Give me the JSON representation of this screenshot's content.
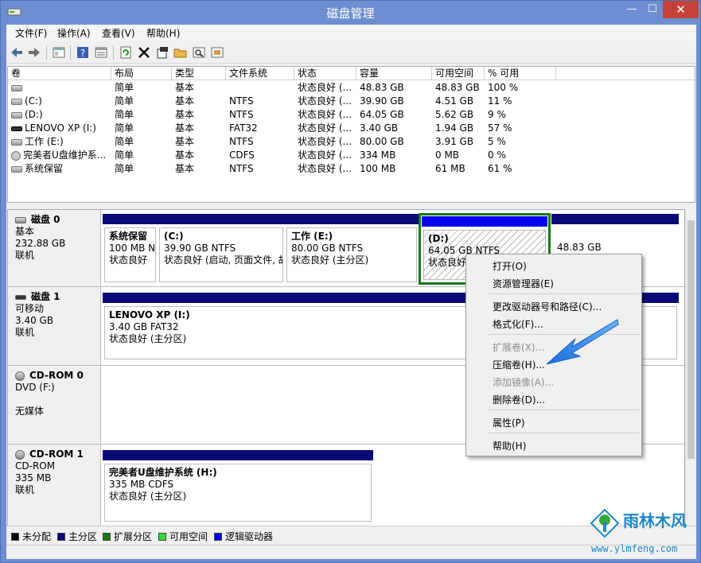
{
  "window": {
    "title": "磁盘管理",
    "min": "—",
    "max": "☐",
    "close": "✕"
  },
  "menu": [
    "文件(F)",
    "操作(A)",
    "查看(V)",
    "帮助(H)"
  ],
  "toolbar_icons": [
    "back-arrow-icon",
    "forward-arrow-icon",
    "properties-view-icon",
    "help-icon",
    "list-view-icon",
    "refresh-icon",
    "delete-icon",
    "properties-icon",
    "open-folder-icon",
    "search-icon",
    "extra-icon"
  ],
  "columns": [
    "卷",
    "布局",
    "类型",
    "文件系统",
    "状态",
    "容量",
    "可用空间",
    "% 可用"
  ],
  "volumes": [
    {
      "name": "",
      "layout": "简单",
      "type": "基本",
      "fs": "",
      "status": "状态良好 (...",
      "cap": "48.83 GB",
      "free": "48.83 GB",
      "pct": "100 %",
      "icon": "disk"
    },
    {
      "name": "(C:)",
      "layout": "简单",
      "type": "基本",
      "fs": "NTFS",
      "status": "状态良好 (...",
      "cap": "39.90 GB",
      "free": "4.51 GB",
      "pct": "11 %",
      "icon": "disk"
    },
    {
      "name": "(D:)",
      "layout": "简单",
      "type": "基本",
      "fs": "NTFS",
      "status": "状态良好 (...",
      "cap": "64.05 GB",
      "free": "5.62 GB",
      "pct": "9 %",
      "icon": "disk"
    },
    {
      "name": "LENOVO XP (I:)",
      "layout": "简单",
      "type": "基本",
      "fs": "FAT32",
      "status": "状态良好 (...",
      "cap": "3.40 GB",
      "free": "1.94 GB",
      "pct": "57 %",
      "icon": "usb"
    },
    {
      "name": "工作 (E:)",
      "layout": "简单",
      "type": "基本",
      "fs": "NTFS",
      "status": "状态良好 (...",
      "cap": "80.00 GB",
      "free": "3.91 GB",
      "pct": "5 %",
      "icon": "disk"
    },
    {
      "name": "完美者U盘维护系...",
      "layout": "简单",
      "type": "基本",
      "fs": "CDFS",
      "status": "状态良好 (...",
      "cap": "334 MB",
      "free": "0 MB",
      "pct": "0 %",
      "icon": "cd"
    },
    {
      "name": "系统保留",
      "layout": "简单",
      "type": "基本",
      "fs": "NTFS",
      "status": "状态良好 (...",
      "cap": "100 MB",
      "free": "61 MB",
      "pct": "61 %",
      "icon": "disk"
    }
  ],
  "disks": [
    {
      "name": "磁盘 0",
      "l2": "基本",
      "l3": "232.88 GB",
      "l4": "联机",
      "parts": [
        {
          "name": "系统保留",
          "l2": "100 MB N",
          "l3": "状态良好"
        },
        {
          "name": "(C:)",
          "l2": "39.90 GB NTFS",
          "l3": "状态良好 (启动, 页面文件, 故"
        },
        {
          "name": "工作  (E:)",
          "l2": "80.00 GB NTFS",
          "l3": "状态良好 (主分区)"
        },
        {
          "name": "(D:)",
          "l2": "64.05 GB NTFS",
          "l3": "状态良好"
        },
        {
          "name": "",
          "l2": "48.83 GB",
          "l3": ""
        }
      ]
    },
    {
      "name": "磁盘 1",
      "l2": "可移动",
      "l3": "3.40 GB",
      "l4": "联机",
      "parts": [
        {
          "name": "LENOVO XP  (I:)",
          "l2": "3.40 GB FAT32",
          "l3": "状态良好 (主分区)"
        }
      ]
    },
    {
      "name": "CD-ROM 0",
      "l2": "DVD (F:)",
      "l3": "",
      "l4": "无媒体",
      "parts": []
    },
    {
      "name": "CD-ROM 1",
      "l2": "CD-ROM",
      "l3": "335 MB",
      "l4": "联机",
      "parts": [
        {
          "name": "完美者U盘维护系统  (H:)",
          "l2": "335 MB CDFS",
          "l3": "状态良好 (主分区)"
        }
      ]
    }
  ],
  "legend": [
    {
      "label": "未分配",
      "color": "#000000"
    },
    {
      "label": "主分区",
      "color": "#0a0a78"
    },
    {
      "label": "扩展分区",
      "color": "#147a14"
    },
    {
      "label": "可用空间",
      "color": "#33dd33"
    },
    {
      "label": "逻辑驱动器",
      "color": "#0000ee"
    }
  ],
  "context_menu": [
    {
      "label": "打开(O)",
      "enabled": true
    },
    {
      "label": "资源管理器(E)",
      "enabled": true
    },
    {
      "label": "更改驱动器号和路径(C)...",
      "enabled": true
    },
    {
      "label": "格式化(F)...",
      "enabled": true
    },
    {
      "label": "扩展卷(X)...",
      "enabled": false
    },
    {
      "label": "压缩卷(H)...",
      "enabled": true
    },
    {
      "label": "添加镜像(A)...",
      "enabled": false
    },
    {
      "label": "删除卷(D)...",
      "enabled": true
    },
    {
      "label": "属性(P)",
      "enabled": true
    },
    {
      "label": "帮助(H)",
      "enabled": true
    }
  ],
  "watermark": {
    "text": "雨林木风",
    "url": "www.ylmfeng.com"
  }
}
